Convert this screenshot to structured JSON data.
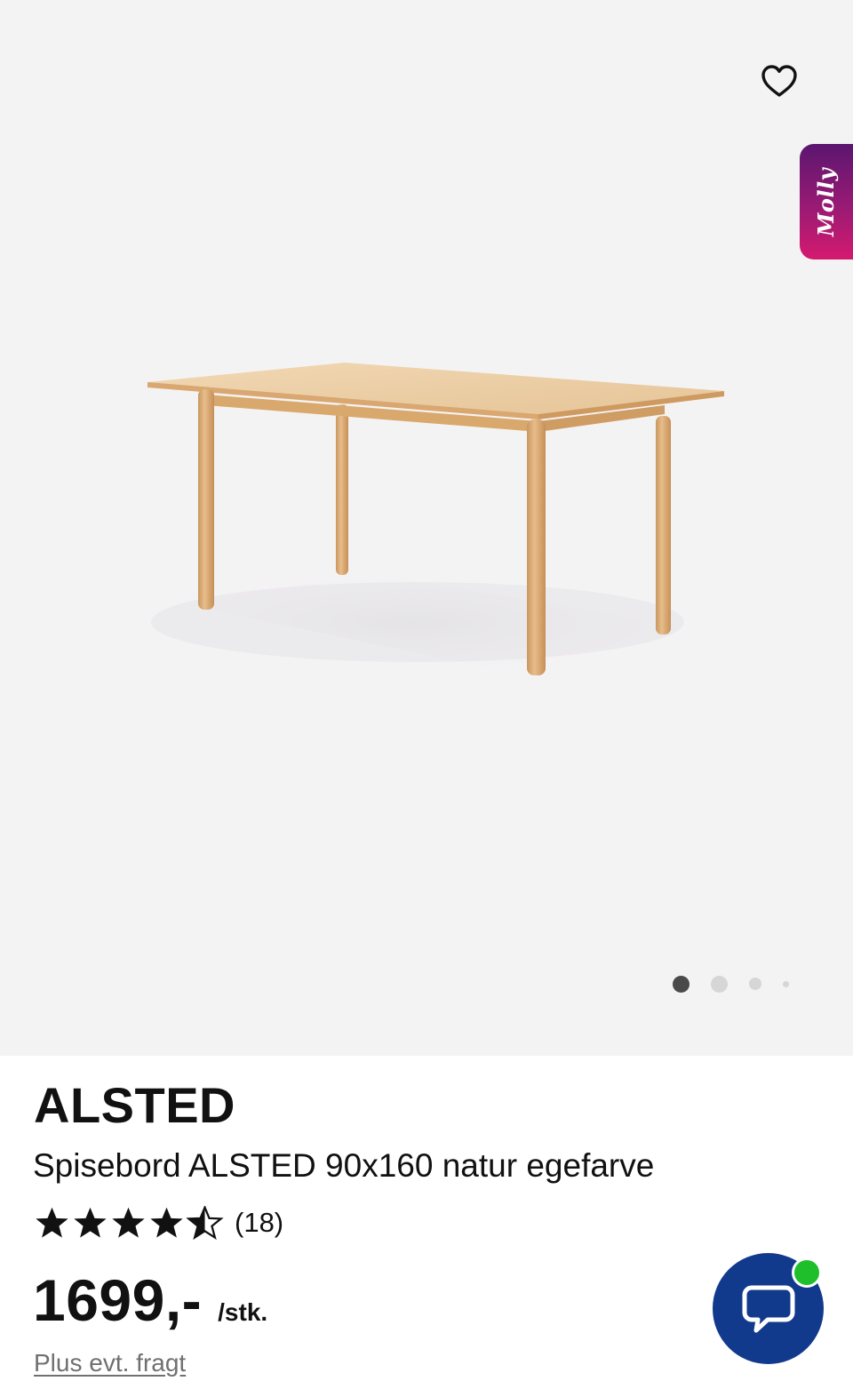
{
  "gallery": {
    "image_alt": "Spisebord ALSTED 90x160 natur egefarve",
    "slide_count": 4,
    "active_slide": 1,
    "colors": {
      "background": "#f4f3f4",
      "active_dot": "#4a4a4a",
      "inactive_dot": "#d6d6d6"
    }
  },
  "favorite": {
    "icon": "heart-outline-icon"
  },
  "molly": {
    "label": "Molly",
    "gradient": [
      "#5b1670",
      "#d41a6f"
    ]
  },
  "product": {
    "brand": "ALSTED",
    "title": "Spisebord ALSTED 90x160 natur egefarve",
    "rating": {
      "value": 4.5,
      "max": 5,
      "count_label": "(18)"
    },
    "price": "1699,-",
    "unit": "/stk.",
    "shipping_note": "Plus evt. fragt"
  },
  "chat": {
    "icon": "chat-bubble-icon",
    "status": "online",
    "button_color": "#123a8c",
    "status_color": "#1fbf2c"
  }
}
